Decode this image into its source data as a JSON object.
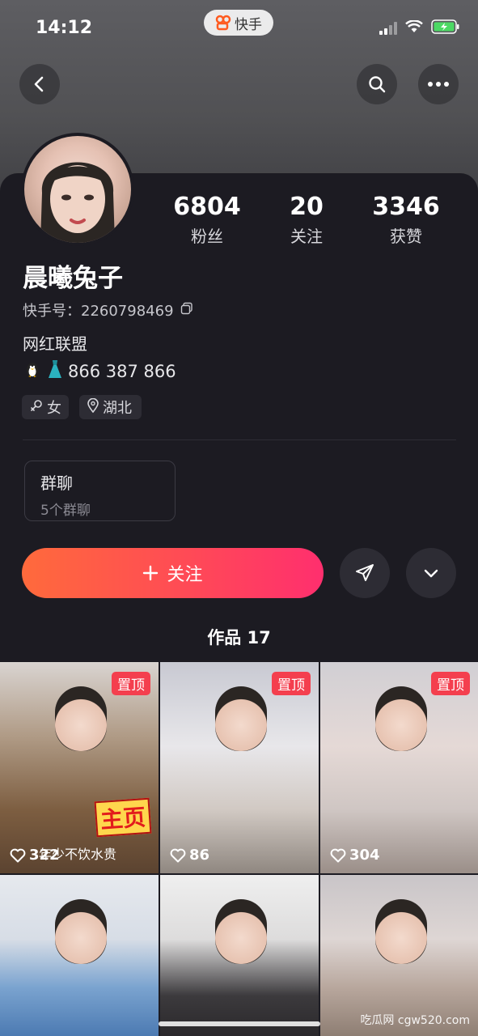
{
  "status_bar": {
    "time": "14:12",
    "app_name": "快手"
  },
  "profile": {
    "name": "晨曦兔子",
    "kuaishou_id_label": "快手号：",
    "kuaishou_id": "2260798469",
    "bio_line1": "网红联盟",
    "bio_line2": "866 387 866",
    "gender_tag": "女",
    "location_tag": "湖北",
    "stats": [
      {
        "value": "6804",
        "label": "粉丝"
      },
      {
        "value": "20",
        "label": "关注"
      },
      {
        "value": "3346",
        "label": "获赞"
      }
    ]
  },
  "group_chat": {
    "title": "群聊",
    "subtitle": "5个群聊"
  },
  "actions": {
    "follow_label": "关注"
  },
  "works_tab": {
    "label": "作品 17"
  },
  "works": [
    {
      "likes": "322",
      "pinned": "置顶",
      "sticker": "主页",
      "caption": "年少不饮水贵"
    },
    {
      "likes": "86",
      "pinned": "置顶"
    },
    {
      "likes": "304",
      "pinned": "置顶"
    },
    {
      "likes": ""
    },
    {
      "likes": ""
    },
    {
      "likes": ""
    }
  ],
  "watermark": "吃瓜网 cgw520.com",
  "colors": {
    "accent_start": "#ff6a3c",
    "accent_end": "#ff2f6e",
    "pin": "#f43f4e",
    "background": "#1c1b22"
  }
}
